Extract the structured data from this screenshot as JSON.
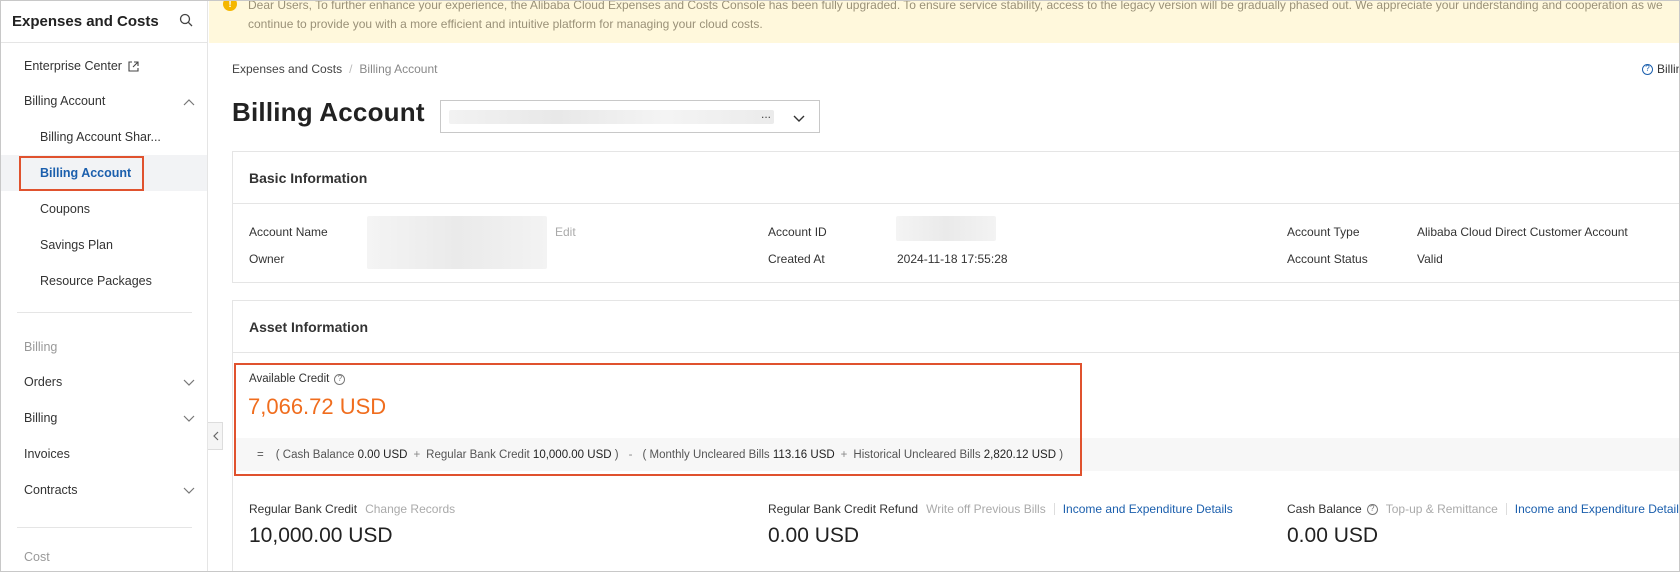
{
  "sidebar": {
    "title": "Expenses and Costs",
    "items": [
      {
        "label": "Enterprise Center"
      },
      {
        "label": "Billing Account"
      },
      {
        "label": "Billing Account Shar..."
      },
      {
        "label": "Billing Account"
      },
      {
        "label": "Coupons"
      },
      {
        "label": "Savings Plan"
      },
      {
        "label": "Resource Packages"
      },
      {
        "label": "Orders"
      },
      {
        "label": "Billing"
      },
      {
        "label": "Invoices"
      },
      {
        "label": "Contracts"
      }
    ],
    "groups": {
      "billing": "Billing",
      "cost": "Cost"
    }
  },
  "notice": {
    "text": "Dear Users, To further enhance your experience, the Alibaba Cloud Expenses and Costs Console has been fully upgraded. To ensure service stability, access to the legacy version will be gradually phased out. We appreciate your understanding and cooperation as we continue to provide you with a more efficient and intuitive platform for managing your cloud costs."
  },
  "breadcrumb": {
    "root": "Expenses and Costs",
    "current": "Billing Account"
  },
  "help_link": "Billin",
  "page_title": "Billing Account",
  "account_select": {
    "suffix": "..."
  },
  "basic": {
    "title": "Basic Information",
    "account_name_label": "Account Name",
    "edit_label": "Edit",
    "owner_label": "Owner",
    "account_id_label": "Account ID",
    "created_at_label": "Created At",
    "created_at_value": "2024-11-18 17:55:28",
    "account_type_label": "Account Type",
    "account_type_value": "Alibaba Cloud Direct Customer Account",
    "account_status_label": "Account Status",
    "account_status_value": "Valid"
  },
  "asset": {
    "title": "Asset Information",
    "available_credit_label": "Available Credit",
    "available_credit_value": "7,066.72 USD",
    "formula": {
      "eq": "=",
      "open1": "(",
      "cash_label": "Cash Balance",
      "cash_value": "0.00 USD",
      "plus1": "+",
      "regular_label": "Regular Bank Credit",
      "regular_value": "10,000.00 USD",
      "close1": ")",
      "minus": "-",
      "open2": "(",
      "monthly_label": "Monthly Uncleared Bills",
      "monthly_value": "113.16 USD",
      "plus2": "+",
      "historical_label": "Historical Uncleared Bills",
      "historical_value": "2,820.12 USD",
      "close2": ")"
    },
    "regular_credit": {
      "label": "Regular Bank Credit",
      "link": "Change Records",
      "value": "10,000.00 USD"
    },
    "regular_refund": {
      "label": "Regular Bank Credit Refund",
      "link1": "Write off Previous Bills",
      "link2": "Income and Expenditure Details",
      "value": "0.00 USD"
    },
    "cash_balance": {
      "label": "Cash Balance",
      "link1": "Top-up & Remittance",
      "link2": "Income and Expenditure Details",
      "value": "0.00 USD"
    }
  },
  "colors": {
    "accent": "#1b5fad",
    "highlight": "#e0522e",
    "credit": "#f06d1e"
  }
}
